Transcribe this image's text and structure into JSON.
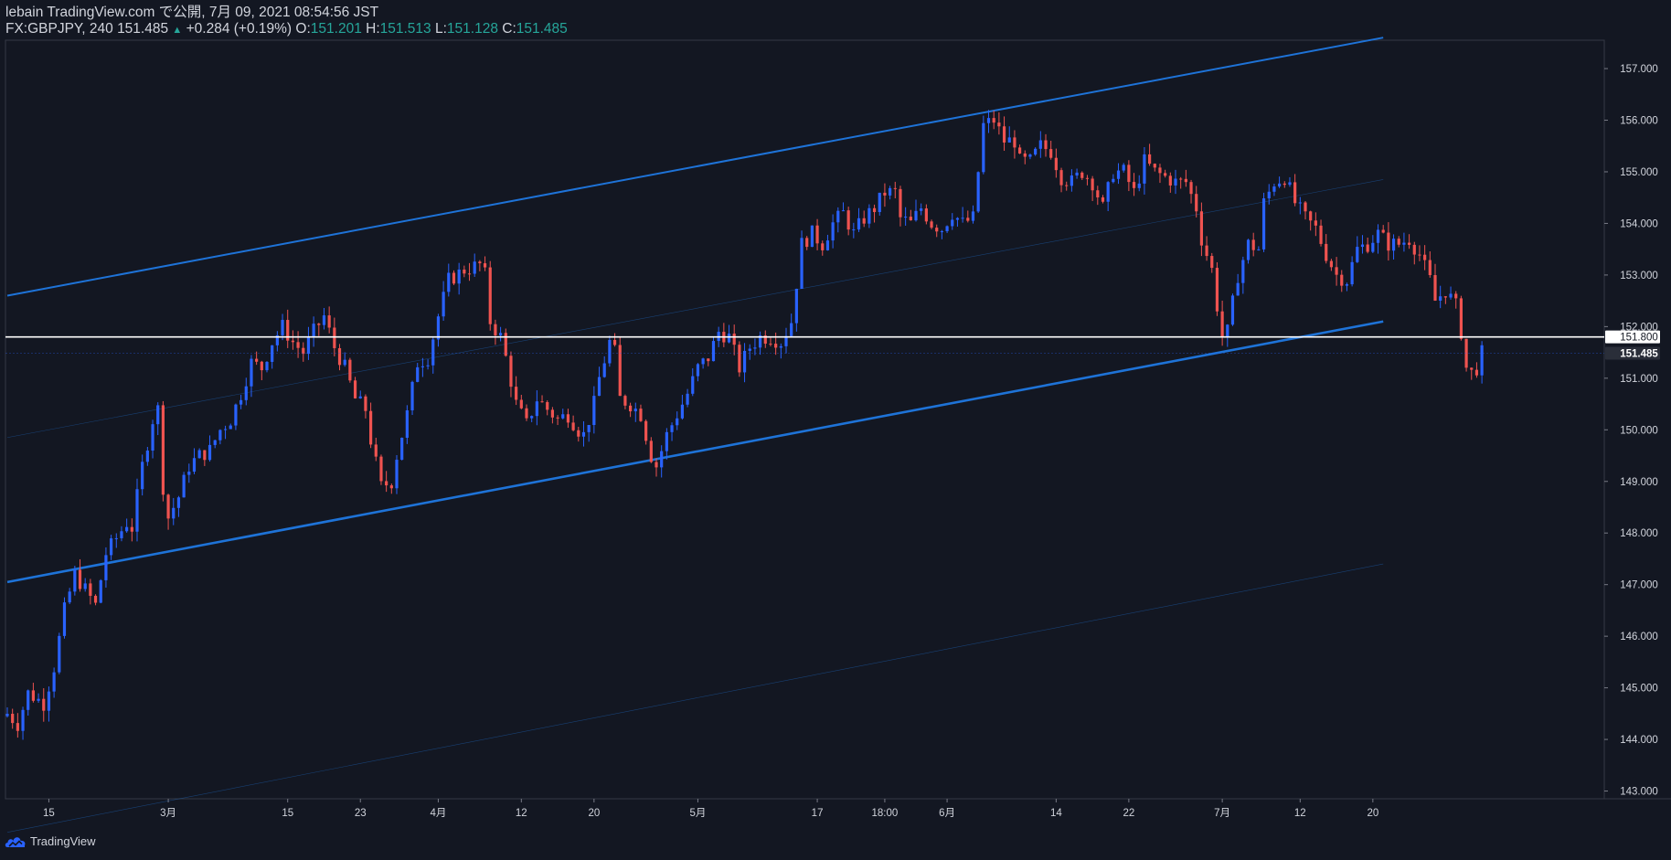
{
  "header": {
    "line1": "lebain TradingView.com で公開, 7月 09, 2021 08:54:56 JST",
    "symbol": "FX:GBPJPY, 240",
    "last": "151.485",
    "change_arrow": "▲",
    "change": "+0.284 (+0.19%)",
    "o_label": "O:",
    "o_val": "151.201",
    "h_label": "H:",
    "h_val": "151.513",
    "l_label": "L:",
    "l_val": "151.128",
    "c_label": "C:",
    "c_val": "151.485"
  },
  "footer": {
    "brand": "TradingView",
    "logo_icon": "tradingview-cloud-icon"
  },
  "colors": {
    "background": "#131722",
    "up": "#2962ff",
    "down": "#ef5350",
    "channel": "#1e73d8",
    "hline": "#ffffff",
    "grid": "#2a2e39",
    "text": "#d1d4dc"
  },
  "chart_data": {
    "type": "candlestick",
    "interval": "240",
    "symbol": "FX:GBPJPY",
    "y_axis": {
      "ticks": [
        143.0,
        144.0,
        145.0,
        146.0,
        147.0,
        148.0,
        149.0,
        150.0,
        151.0,
        152.0,
        153.0,
        154.0,
        155.0,
        156.0,
        157.0
      ],
      "tick_labels": [
        "143.000",
        "144.000",
        "145.000",
        "146.000",
        "147.000",
        "148.000",
        "149.000",
        "150.000",
        "151.000",
        "152.000",
        "153.000",
        "154.000",
        "155.000",
        "156.000",
        "157.000"
      ],
      "range": [
        142.85,
        157.55
      ]
    },
    "x_axis": {
      "ticks": [
        "15",
        "3月",
        "15",
        "23",
        "4月",
        "12",
        "20",
        "5月",
        "17",
        "18:00",
        "6月",
        "14",
        "22",
        "7月",
        "12",
        "20"
      ],
      "index": [
        8,
        31,
        54,
        68,
        83,
        99,
        113,
        133,
        156,
        169,
        181,
        202,
        216,
        234,
        249,
        263
      ]
    },
    "last_price": {
      "value": 151.485,
      "label": "151.485"
    },
    "horizontal_level": {
      "value": 151.8,
      "label": "151.800"
    },
    "channel": {
      "lower": [
        [
          0,
          147.05
        ],
        [
          265,
          152.1
        ]
      ],
      "upper": [
        [
          0,
          152.6
        ],
        [
          265,
          157.6
        ]
      ],
      "inner_upper": [
        [
          0,
          149.85
        ],
        [
          265,
          154.85
        ]
      ],
      "outer_lower": [
        [
          0,
          142.2
        ],
        [
          265,
          147.4
        ]
      ]
    },
    "price_path": [
      [
        0,
        144.5
      ],
      [
        2,
        144.3
      ],
      [
        4,
        144.9
      ],
      [
        7,
        144.7
      ],
      [
        9,
        145.4
      ],
      [
        11,
        146.5
      ],
      [
        13,
        147.2
      ],
      [
        15,
        146.9
      ],
      [
        17,
        146.6
      ],
      [
        19,
        147.6
      ],
      [
        21,
        147.9
      ],
      [
        23,
        148.2
      ],
      [
        24,
        148.1
      ],
      [
        26,
        149.3
      ],
      [
        28,
        150.2
      ],
      [
        29,
        150.4
      ],
      [
        30,
        148.9
      ],
      [
        31,
        148.3
      ],
      [
        33,
        148.7
      ],
      [
        35,
        149.3
      ],
      [
        37,
        149.5
      ],
      [
        39,
        149.6
      ],
      [
        41,
        150.0
      ],
      [
        43,
        150.2
      ],
      [
        45,
        150.7
      ],
      [
        47,
        151.3
      ],
      [
        49,
        151.2
      ],
      [
        51,
        151.7
      ],
      [
        53,
        152.0
      ],
      [
        55,
        151.7
      ],
      [
        57,
        151.5
      ],
      [
        59,
        151.9
      ],
      [
        61,
        152.2
      ],
      [
        63,
        151.6
      ],
      [
        65,
        151.2
      ],
      [
        67,
        150.6
      ],
      [
        69,
        150.4
      ],
      [
        70,
        149.8
      ],
      [
        72,
        148.9
      ],
      [
        74,
        149.0
      ],
      [
        75,
        149.5
      ],
      [
        77,
        150.3
      ],
      [
        79,
        151.3
      ],
      [
        81,
        151.4
      ],
      [
        83,
        152.2
      ],
      [
        85,
        152.9
      ],
      [
        88,
        153.1
      ],
      [
        91,
        153.2
      ],
      [
        92,
        153.0
      ],
      [
        93,
        152.1
      ],
      [
        95,
        151.8
      ],
      [
        96,
        151.4
      ],
      [
        98,
        150.5
      ],
      [
        100,
        150.1
      ],
      [
        102,
        150.6
      ],
      [
        104,
        150.4
      ],
      [
        106,
        150.2
      ],
      [
        108,
        150.3
      ],
      [
        110,
        150.0
      ],
      [
        111,
        149.9
      ],
      [
        113,
        150.5
      ],
      [
        114,
        151.0
      ],
      [
        116,
        151.7
      ],
      [
        117,
        151.5
      ],
      [
        118,
        150.6
      ],
      [
        120,
        150.5
      ],
      [
        122,
        150.3
      ],
      [
        124,
        149.5
      ],
      [
        125,
        149.3
      ],
      [
        127,
        149.9
      ],
      [
        129,
        150.3
      ],
      [
        131,
        150.7
      ],
      [
        133,
        151.2
      ],
      [
        135,
        151.4
      ],
      [
        137,
        151.9
      ],
      [
        139,
        151.8
      ],
      [
        141,
        151.2
      ],
      [
        143,
        151.6
      ],
      [
        145,
        151.8
      ],
      [
        147,
        151.8
      ],
      [
        149,
        151.7
      ],
      [
        151,
        152.1
      ],
      [
        153,
        153.6
      ],
      [
        155,
        153.8
      ],
      [
        157,
        153.6
      ],
      [
        159,
        154.0
      ],
      [
        161,
        154.2
      ],
      [
        163,
        153.8
      ],
      [
        165,
        154.1
      ],
      [
        167,
        154.3
      ],
      [
        169,
        154.6
      ],
      [
        171,
        154.6
      ],
      [
        172,
        154.1
      ],
      [
        174,
        154.0
      ],
      [
        176,
        154.3
      ],
      [
        178,
        154.0
      ],
      [
        180,
        153.9
      ],
      [
        182,
        154.2
      ],
      [
        184,
        154.0
      ],
      [
        186,
        154.1
      ],
      [
        187,
        155.0
      ],
      [
        188,
        155.9
      ],
      [
        190,
        156.0
      ],
      [
        192,
        155.6
      ],
      [
        194,
        155.6
      ],
      [
        195,
        155.2
      ],
      [
        197,
        155.2
      ],
      [
        199,
        155.5
      ],
      [
        201,
        155.4
      ],
      [
        203,
        154.9
      ],
      [
        205,
        154.8
      ],
      [
        207,
        155.0
      ],
      [
        209,
        154.8
      ],
      [
        211,
        154.3
      ],
      [
        213,
        155.0
      ],
      [
        215,
        155.0
      ],
      [
        217,
        154.6
      ],
      [
        219,
        155.2
      ],
      [
        221,
        155.0
      ],
      [
        223,
        154.9
      ],
      [
        225,
        154.8
      ],
      [
        227,
        154.8
      ],
      [
        229,
        154.3
      ],
      [
        230,
        153.7
      ],
      [
        232,
        153.1
      ],
      [
        233,
        152.4
      ],
      [
        234,
        151.8
      ],
      [
        235,
        151.9
      ],
      [
        237,
        153.0
      ],
      [
        239,
        153.6
      ],
      [
        241,
        153.5
      ],
      [
        242,
        154.4
      ],
      [
        244,
        154.8
      ],
      [
        246,
        154.9
      ],
      [
        248,
        154.4
      ],
      [
        250,
        154.1
      ],
      [
        252,
        153.9
      ],
      [
        254,
        153.4
      ],
      [
        256,
        153.0
      ],
      [
        258,
        152.9
      ],
      [
        260,
        153.5
      ],
      [
        262,
        153.6
      ],
      [
        264,
        153.8
      ],
      [
        266,
        153.6
      ],
      [
        268,
        153.6
      ],
      [
        270,
        153.7
      ],
      [
        272,
        153.4
      ],
      [
        274,
        152.9
      ],
      [
        275,
        152.5
      ],
      [
        277,
        152.7
      ],
      [
        279,
        152.4
      ],
      [
        280,
        151.9
      ],
      [
        281,
        151.2
      ],
      [
        282,
        151.1
      ],
      [
        283,
        151.2
      ],
      [
        284,
        151.485
      ]
    ]
  }
}
